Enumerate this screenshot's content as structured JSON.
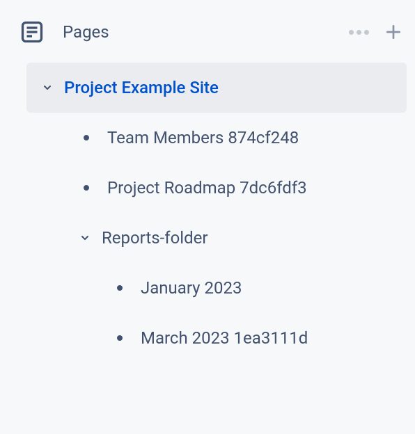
{
  "header": {
    "title": "Pages"
  },
  "tree": {
    "root": {
      "label": "Project Example Site",
      "selected": true,
      "expanded": true
    },
    "items": [
      {
        "label": "Team Members 874cf248",
        "type": "page"
      },
      {
        "label": "Project Roadmap 7dc6fdf3",
        "type": "page"
      },
      {
        "label": "Reports-folder",
        "type": "folder",
        "expanded": true
      }
    ],
    "subitems": [
      {
        "label": "January 2023",
        "type": "page"
      },
      {
        "label": "March 2023 1ea3111d",
        "type": "page"
      }
    ]
  }
}
